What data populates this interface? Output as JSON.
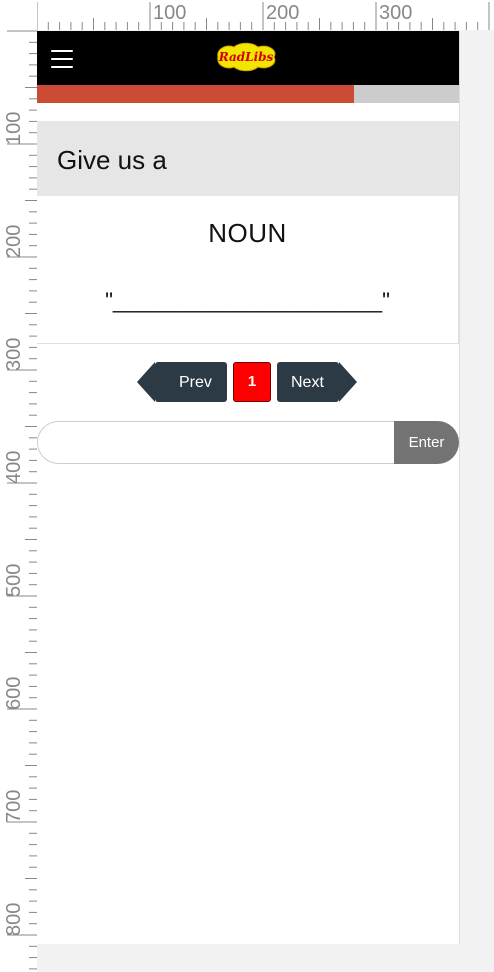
{
  "ruler": {
    "top_labels": [
      "100",
      "200",
      "300"
    ],
    "left_labels": [
      "100",
      "200",
      "300",
      "400",
      "500",
      "600",
      "700",
      "800"
    ]
  },
  "header": {
    "menu_icon": "hamburger-menu-icon",
    "logo_text": "RadLibs"
  },
  "progress": {
    "fraction": 0.75,
    "fill_color": "#cc4b35",
    "track_color": "#cccccc"
  },
  "prompt": {
    "text": "Give us a"
  },
  "card": {
    "word_type": "NOUN",
    "blank": "\"______________________\""
  },
  "pagination": {
    "prev_label": "Prev",
    "current_page": "1",
    "next_label": "Next",
    "active_color": "#ff0000",
    "button_color": "#2c3a45"
  },
  "entry": {
    "value": "",
    "placeholder": "",
    "enter_label": "Enter"
  }
}
